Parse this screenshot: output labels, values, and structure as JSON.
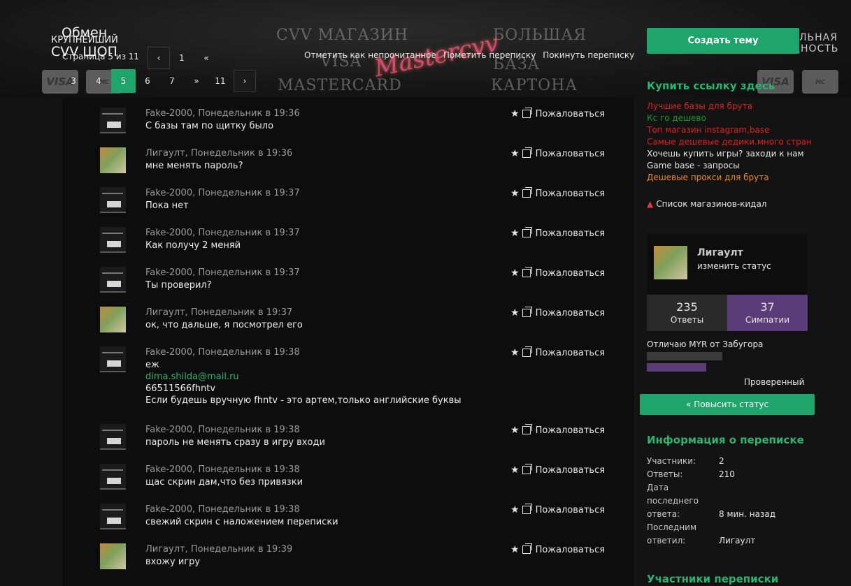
{
  "header": {
    "title": "Обмен",
    "subtitle_small": "КРУПНЕЙШИЙ",
    "subtitle_big": "CVV ШОП",
    "page_info": "Страница 5 из 11",
    "banner_words": [
      "CVV МАГАЗИН",
      "БОЛЬШАЯ",
      "VISA",
      "БАЗА",
      "MASTERCARD",
      "КАРТОНА",
      "ЛЬНАЯ",
      "ДНОСТЬ"
    ],
    "banner_logo": "Mastercvv"
  },
  "pagination": {
    "prev_label": "‹",
    "next_label": "›",
    "items": [
      "1",
      "«",
      "3",
      "4",
      "5",
      "6",
      "7",
      "»",
      "11"
    ],
    "active": "5"
  },
  "top_actions": [
    "Отметить как непрочитанное",
    "Пометить переписку",
    "Покинуть переписку"
  ],
  "messages": [
    {
      "author": "Fake-2000",
      "time": "Понедельник в 19:36",
      "meta": "Fake-2000, Понедельник в 19:36",
      "lines": [
        "С базы там по щитку было"
      ],
      "avatar": "screen"
    },
    {
      "author": "Лигаулт",
      "time": "Понедельник в 19:36",
      "meta": "Лигаулт, Понедельник в 19:36",
      "lines": [
        "мне менять пароль?"
      ],
      "avatar": "person"
    },
    {
      "author": "Fake-2000",
      "time": "Понедельник в 19:37",
      "meta": "Fake-2000, Понедельник в 19:37",
      "lines": [
        "Пока нет"
      ],
      "avatar": "screen"
    },
    {
      "author": "Fake-2000",
      "time": "Понедельник в 19:37",
      "meta": "Fake-2000, Понедельник в 19:37",
      "lines": [
        "Как получу 2 меняй"
      ],
      "avatar": "screen"
    },
    {
      "author": "Fake-2000",
      "time": "Понедельник в 19:37",
      "meta": "Fake-2000, Понедельник в 19:37",
      "lines": [
        "Ты проверил?"
      ],
      "avatar": "screen"
    },
    {
      "author": "Лигаулт",
      "time": "Понедельник в 19:37",
      "meta": "Лигаулт, Понедельник в 19:37",
      "lines": [
        "ок, что дальше, я посмотрел его"
      ],
      "avatar": "person"
    },
    {
      "author": "Fake-2000",
      "time": "Понедельник в 19:38",
      "meta": "Fake-2000, Понедельник в 19:38",
      "lines": [
        "еж"
      ],
      "link": "dima.shilda@mail.ru",
      "after": [
        "66511566fhntv",
        "Если будешь вручную fhntv - это артем,только английские буквы"
      ],
      "avatar": "screen"
    },
    {
      "author": "Fake-2000",
      "time": "Понедельник в 19:38",
      "meta": "Fake-2000, Понедельник в 19:38",
      "lines": [
        "пароль не менять сразу в игру входи"
      ],
      "avatar": "screen"
    },
    {
      "author": "Fake-2000",
      "time": "Понедельник в 19:38",
      "meta": "Fake-2000, Понедельник в 19:38",
      "lines": [
        "щас скрин дам,что без привязки"
      ],
      "avatar": "screen"
    },
    {
      "author": "Fake-2000",
      "time": "Понедельник в 19:38",
      "meta": "Fake-2000, Понедельник в 19:38",
      "lines": [
        "свежий скрин с наложением переписки"
      ],
      "avatar": "screen"
    },
    {
      "author": "Лигаулт",
      "time": "Понедельник в 19:39",
      "meta": "Лигаулт, Понедельник в 19:39",
      "lines": [
        "вхожу игру"
      ],
      "avatar": "person"
    }
  ],
  "message_action": "Пожаловаться",
  "sidebar": {
    "create_button": "Создать тему",
    "buy_link_heading": "Купить ссылку здесь",
    "ads": [
      {
        "text": "Лучшие базы для брута",
        "color": "#e02020"
      },
      {
        "text": "Кс го дешево",
        "color": "#1a9a2a"
      },
      {
        "text": "Топ магазин instagram,base",
        "color": "#e02020"
      },
      {
        "text": "Самые дешевые дедики.много стран",
        "color": "#e02020"
      },
      {
        "text": "Хочешь купить игры? заходи к нам",
        "color": "#e6e6e6"
      },
      {
        "text": "Game base - запросы",
        "color": "#e6e6e6"
      },
      {
        "text": "Дешевые прокси для брута",
        "color": "#f08a20"
      }
    ],
    "scam_list": "Список магазинов-кидал",
    "profile": {
      "name": "Лигаулт",
      "status_link": "изменить статус",
      "answers_count": "235",
      "answers_label": "Ответы",
      "likes_count": "37",
      "likes_label": "Симпатии",
      "user_title": "Отличаю MYR от Забугора",
      "verified": "Проверенный"
    },
    "raise_button": "Повысить статус",
    "info_heading": "Информация о переписке",
    "info": {
      "participants_label": "Участники:",
      "participants_value": "2",
      "answers_label": "Ответы:",
      "answers_value": "210",
      "last_answer_label_1": "Дата",
      "last_answer_label_2": "последнего",
      "last_answer_label_3": "ответа:",
      "last_answer_value": "8 мин. назад",
      "last_replied_label_1": "Последним",
      "last_replied_label_2": "ответил:",
      "last_replied_value": "Лигаулт"
    },
    "participants_heading": "Участники переписки"
  },
  "colors": {
    "accent": "#1fa46c",
    "accent_text": "#2db36f",
    "likes_bg": "#5a3d78"
  }
}
